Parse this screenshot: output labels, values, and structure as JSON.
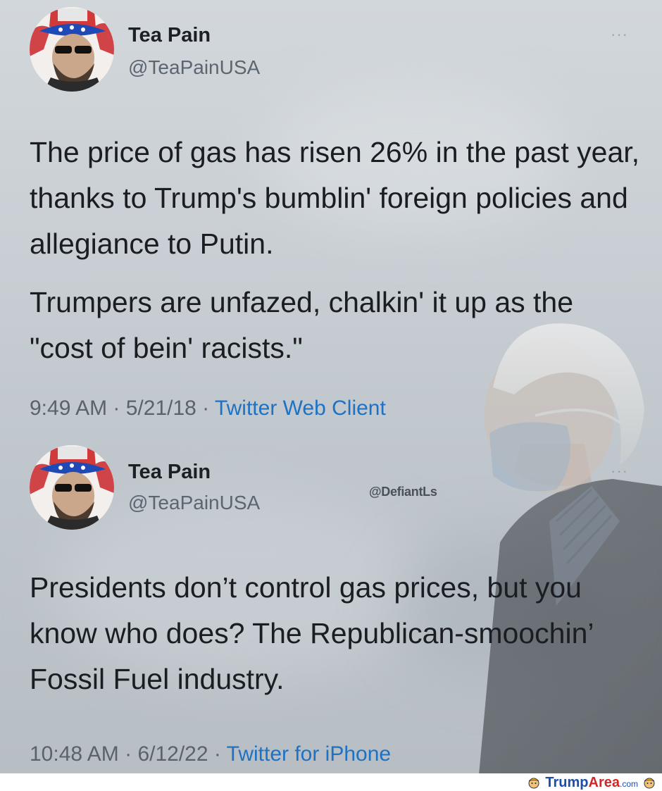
{
  "tweets": [
    {
      "display_name": "Tea Pain",
      "handle": "@TeaPainUSA",
      "more_label": "···",
      "paragraphs": [
        "The price of gas has risen 26% in the past year, thanks to Trump's bumblin' foreign policies and allegiance to Putin.",
        "Trumpers are unfazed, chalkin' it up as the \"cost of bein' racists.\""
      ],
      "time": "9:49 AM",
      "date": "5/21/18",
      "separator": " · ",
      "source": "Twitter Web Client"
    },
    {
      "display_name": "Tea Pain",
      "handle": "@TeaPainUSA",
      "more_label": "···",
      "paragraphs": [
        "Presidents don’t control gas prices, but you know who does? The Republican-smoochin’ Fossil Fuel industry."
      ],
      "time": "10:48 AM",
      "date": "6/12/22",
      "separator": " · ",
      "source": "Twitter for iPhone"
    }
  ],
  "watermark": "@DefiantLs",
  "footer": {
    "brand_main": "Trump",
    "brand_accent": "Area",
    "brand_suffix": ".com"
  },
  "colors": {
    "link": "#1d72c4",
    "text": "#1a1d21",
    "muted": "#59636c",
    "brand_blue": "#1d4fa8",
    "brand_red": "#d32626"
  },
  "icons": [
    "avatar-portrait",
    "more-options-icon",
    "trumparea-logo-icon"
  ]
}
